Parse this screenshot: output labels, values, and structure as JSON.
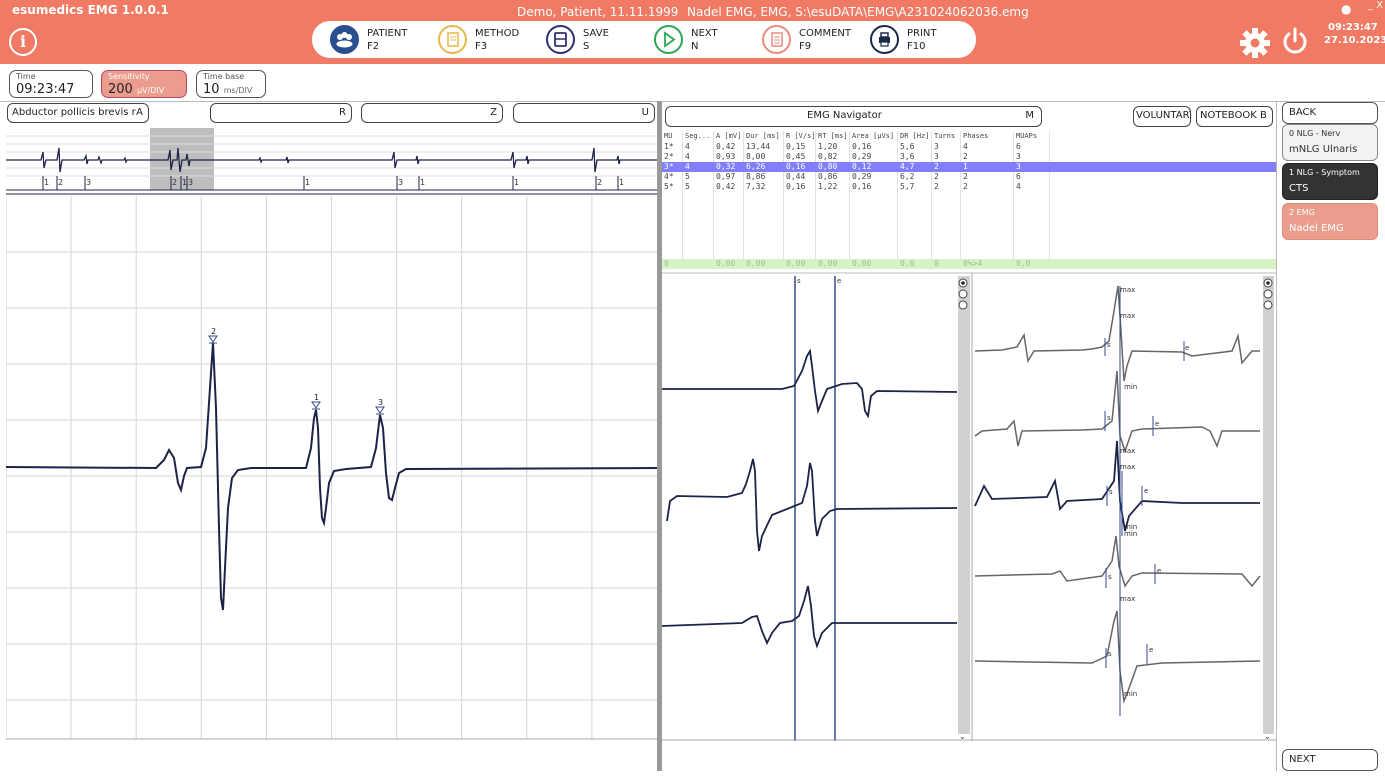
{
  "app": {
    "title": "esumedics EMG   1.0.0.1",
    "patient": "Demo, Patient, 11.11.1999",
    "file": "Nadel EMG, EMG, S:\\esuDATA\\EMG\\A231024062036.emg",
    "clock_time": "09:23:47",
    "clock_date": "27.10.2023",
    "info_icon": "info-icon",
    "settings_icon": "gear-icon",
    "power_icon": "power-icon",
    "minimize_label": "_",
    "close_label": "X"
  },
  "commands": [
    {
      "label": "PATIENT",
      "key": "F2",
      "icon": "patient-icon",
      "color": "#2a4f8f"
    },
    {
      "label": "METHOD",
      "key": "F3",
      "icon": "method-icon",
      "color": "#e8b84a"
    },
    {
      "label": "SAVE",
      "key": "S",
      "icon": "save-icon",
      "color": "#2f3270"
    },
    {
      "label": "NEXT",
      "key": "N",
      "icon": "play-icon",
      "color": "#2aa856"
    },
    {
      "label": "COMMENT",
      "key": "F9",
      "icon": "comment-icon",
      "color": "#e88c7c"
    },
    {
      "label": "PRINT",
      "key": "F10",
      "icon": "printer-icon",
      "color": "#1a2a4a"
    }
  ],
  "params": {
    "time_label": "Time",
    "time_value": "09:23:47",
    "sens_label": "Sensitivity",
    "sens_value": "200",
    "sens_unit": "µV/DIV",
    "tb_label": "Time base",
    "tb_value": "10",
    "tb_unit": "ms/DIV",
    "sens_color": "#ea9d8d"
  },
  "channels": [
    {
      "label": "Abductor pollicis brevis r",
      "key": "A"
    },
    {
      "label": "",
      "key": "R"
    },
    {
      "label": "",
      "key": "Z"
    },
    {
      "label": "",
      "key": "U"
    }
  ],
  "overview_marks": [
    "1",
    "2",
    "3",
    "2",
    "1",
    "3",
    "1",
    "3",
    "1",
    "1",
    "2",
    "1"
  ],
  "trace_marks": [
    "2",
    "1",
    "3"
  ],
  "navigator": {
    "label": "EMG Navigator",
    "key": "M"
  },
  "voluntary_label": "VOLUNTARY",
  "notebook_label": "NOTEBOOK  B",
  "table": {
    "headers": [
      "MU",
      "Seg...",
      "A [mV]",
      "Dur [ms]",
      "R [V/s]",
      "RT [ms]",
      "Area [µVs]",
      "DR [Hz]",
      "Turns",
      "Phases",
      "MUAPs"
    ],
    "rows": [
      [
        "1*",
        "4",
        "0,42",
        "13,44",
        "0,15",
        "1,20",
        "0,16",
        "5,6",
        "3",
        "4",
        "6"
      ],
      [
        "2*",
        "4",
        "0,93",
        "8,00",
        "0,45",
        "0,82",
        "0,29",
        "3,6",
        "3",
        "2",
        "3"
      ],
      [
        "3*",
        "4",
        "0,32",
        "6,26",
        "0,16",
        "0,80",
        "0,12",
        "4,7",
        "2",
        "1",
        "3"
      ],
      [
        "4*",
        "5",
        "0,97",
        "8,86",
        "0,44",
        "0,86",
        "0,29",
        "6,2",
        "2",
        "2",
        "6"
      ],
      [
        "5*",
        "5",
        "0,42",
        "7,32",
        "0,16",
        "1,22",
        "0,16",
        "5,7",
        "2",
        "2",
        "4"
      ]
    ],
    "selected_row": 2,
    "summary": [
      "0",
      "",
      "0,00",
      "0,00",
      "0,00",
      "0,00",
      "0,00",
      "0,0",
      "0",
      "0%>4",
      "0,0"
    ]
  },
  "cursor_labels": {
    "s": "s",
    "e": "e",
    "max": "max",
    "min": "min"
  },
  "side": {
    "back_label": "BACK",
    "next_label": "NEXT",
    "steps": [
      {
        "name": "0 NLG - Nerv",
        "value": "mNLG Ulnaris"
      },
      {
        "name": "1 NLG - Symptom",
        "value": "CTS"
      },
      {
        "name": "2 EMG",
        "value": "Nadel EMG"
      }
    ]
  },
  "colors": {
    "header": "#f07a63",
    "trace": "#1c2347",
    "selection": "#8080ff",
    "summary_bg": "#d9f2c4"
  }
}
